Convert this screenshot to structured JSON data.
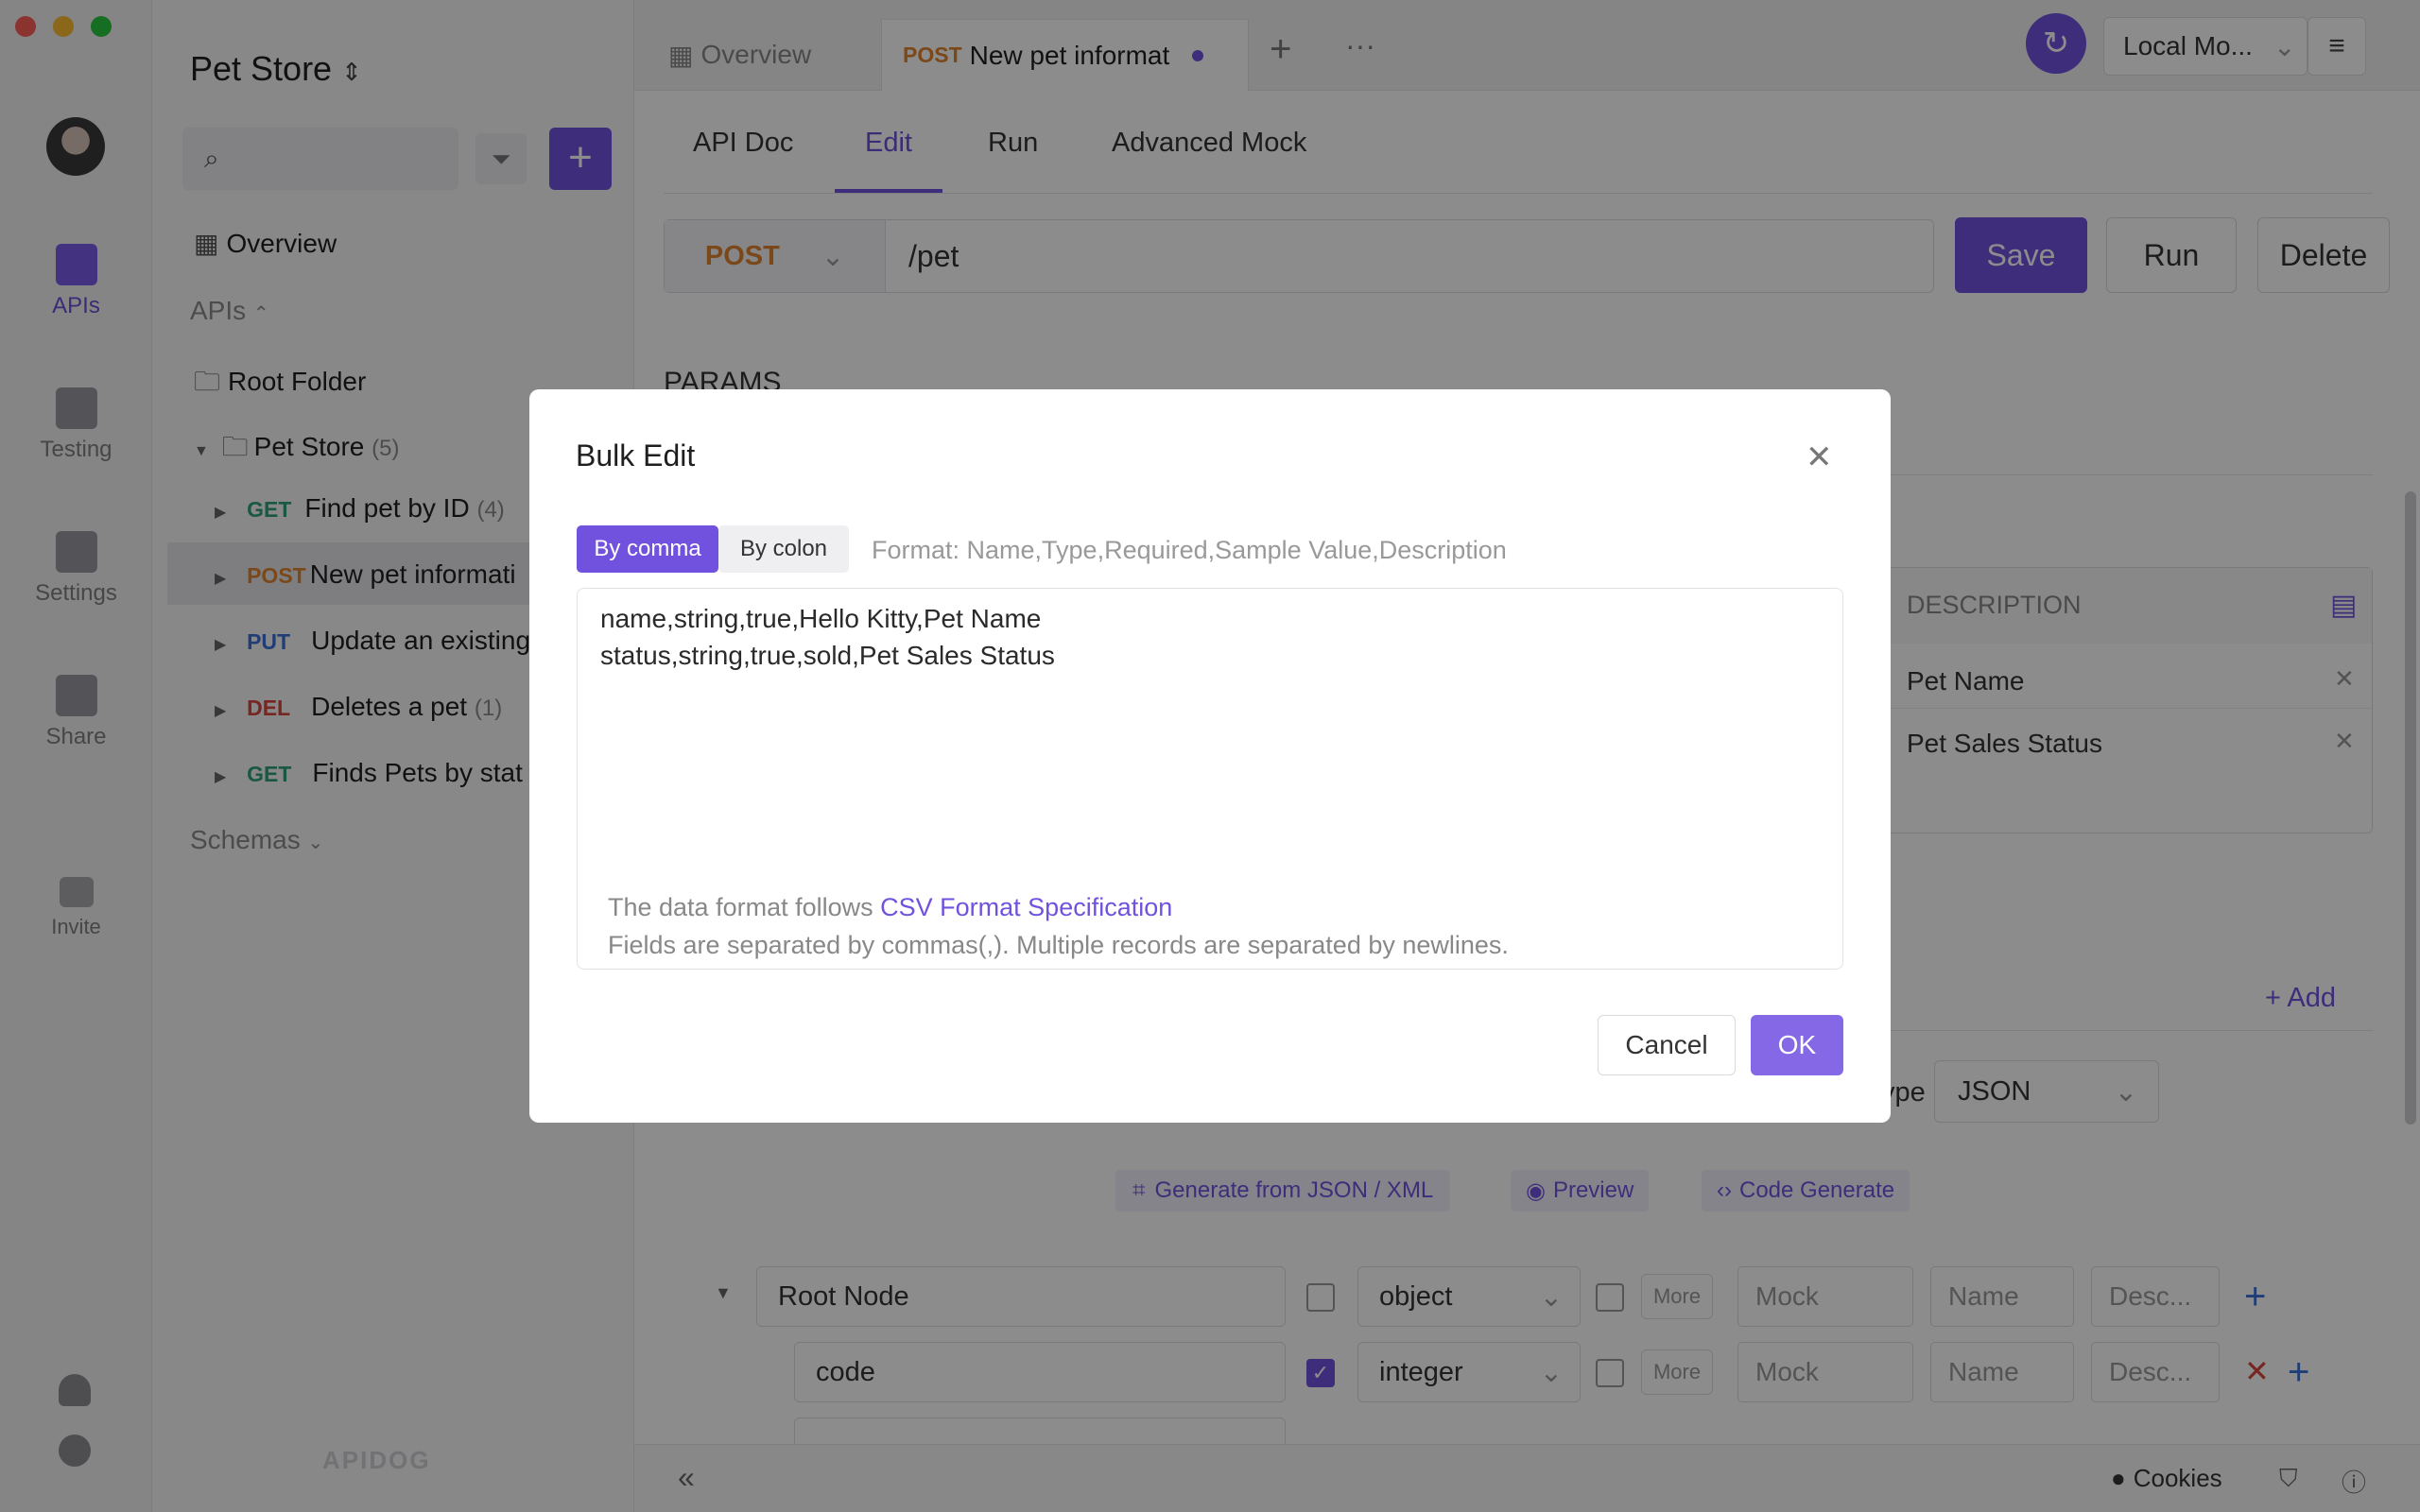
{
  "app": {
    "project_title": "Pet Store",
    "brand_watermark": "APIDOG"
  },
  "rail": {
    "items": [
      {
        "label": "APIs"
      },
      {
        "label": "Testing"
      },
      {
        "label": "Settings"
      },
      {
        "label": "Share"
      },
      {
        "label": "Invite"
      }
    ]
  },
  "sidebar": {
    "search_placeholder": "",
    "overview": "Overview",
    "apis_header": "APIs",
    "root_folder": "Root Folder",
    "folder": {
      "name": "Pet Store",
      "count": "(5)"
    },
    "endpoints": [
      {
        "method": "GET",
        "name": "Find pet by ID",
        "count": "(4)"
      },
      {
        "method": "POST",
        "name": "New pet informati",
        "count": ""
      },
      {
        "method": "PUT",
        "name": "Update an existing",
        "count": ""
      },
      {
        "method": "DEL",
        "name": "Deletes a pet",
        "count": "(1)"
      },
      {
        "method": "GET",
        "name": "Finds Pets by stat",
        "count": ""
      }
    ],
    "schemas": "Schemas"
  },
  "tabs": {
    "overview": "Overview",
    "active_method": "POST",
    "active_name": "New pet informat",
    "env": "Local Mo..."
  },
  "subtabs": [
    "API Doc",
    "Edit",
    "Run",
    "Advanced Mock"
  ],
  "request": {
    "method": "POST",
    "path": "/pet",
    "save": "Save",
    "run": "Run",
    "delete": "Delete"
  },
  "params": {
    "heading": "PARAMS",
    "description_header": "DESCRIPTION",
    "rows": [
      "Pet Name",
      "Pet Sales Status"
    ]
  },
  "body": {
    "add": "+ Add",
    "type_label": "ype",
    "type_value": "JSON",
    "generate": "Generate from JSON / XML",
    "preview": "Preview",
    "code_generate": "Code Generate",
    "rows": [
      {
        "name": "Root Node",
        "type": "object",
        "more": "More",
        "mock": "Mock",
        "name_ph": "Name",
        "desc": "Desc..."
      },
      {
        "name": "code",
        "type": "integer",
        "more": "More",
        "mock": "Mock",
        "name_ph": "Name",
        "desc": "Desc..."
      }
    ]
  },
  "footer": {
    "cookies": "Cookies"
  },
  "modal": {
    "title": "Bulk Edit",
    "seg_comma": "By comma",
    "seg_colon": "By colon",
    "format_hint": "Format: Name,Type,Required,Sample Value,Description",
    "lines": [
      "name,string,true,Hello Kitty,Pet Name",
      "status,string,true,sold,Pet Sales Status"
    ],
    "help_prefix": "The data format follows ",
    "help_link": "CSV Format Specification",
    "help_line2": "Fields are separated by commas(,). Multiple records are separated by newlines.",
    "cancel": "Cancel",
    "ok": "OK"
  },
  "colors": {
    "accent": "#7152df",
    "get": "#2fa37a",
    "post": "#e08430",
    "put": "#3b6fd8",
    "del": "#d9463e"
  }
}
